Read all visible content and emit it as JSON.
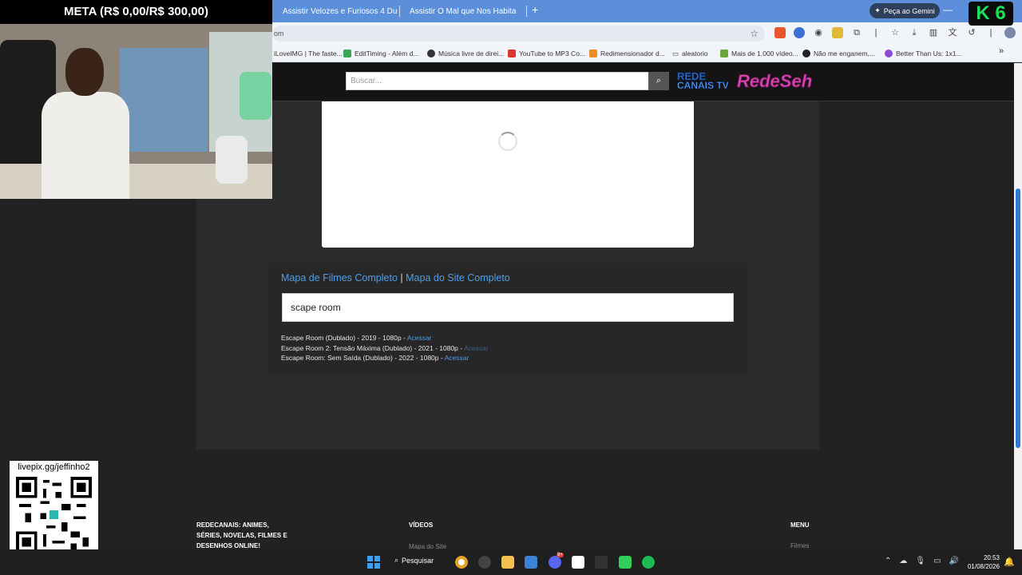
{
  "stream": {
    "meta_banner": "META (R$ 0,00/R$ 300,00)",
    "qr_label": "livepix.gg/jeffinho2",
    "overlay_badge": "K 6"
  },
  "browser": {
    "tabs": [
      {
        "title": "Assistir Velozes e Furiosos 4 Du",
        "close": "✕"
      },
      {
        "title": "Assistir O Mal que Nos Habita",
        "close": "✕"
      }
    ],
    "new_tab": "+",
    "gemini_button": "Peça ao Gemini",
    "address": "om",
    "bookmarks": [
      "iLoveIMG | The faste...",
      "EditTiming - Além d...",
      "Música livre de direi...",
      "YouTube to MP3 Co...",
      "Redimensionador d...",
      "aleatorio",
      "Mais de 1.000 vídeo...",
      "Não me enganem,...",
      "Better Than Us: 1x1..."
    ]
  },
  "site": {
    "search_placeholder": "Buscar...",
    "logo_line1": "REDE",
    "logo_line2": "CANAIS TV",
    "logo_line3": "RedeSeh",
    "map_link_films": "Mapa de Filmes Completo",
    "map_separator": "|",
    "map_link_site": "Mapa do Site Completo",
    "filter_value": "scape room",
    "results": [
      {
        "text": "Escape Room (Dublado) - 2019 - 1080p - ",
        "link": "Acessar",
        "visited": false
      },
      {
        "text": "Escape Room 2: Tensão Máxima (Dublado) - 2021 - 1080p - ",
        "link": "Acessar",
        "visited": true
      },
      {
        "text": "Escape Room: Sem Saída (Dublado) - 2022 - 1080p - ",
        "link": "Acessar",
        "visited": false
      }
    ],
    "footer": {
      "about_title": "REDECANAIS: ANIMES, SÉRIES, NOVELAS, FILMES E DESENHOS ONLINE!",
      "videos_title": "VÍDEOS",
      "videos_link": "Mapa do Site",
      "menu_title": "MENU",
      "menu_link": "Filmes"
    }
  },
  "taskbar": {
    "search_label": "Pesquisar",
    "time": "20:53",
    "date": "01/08/2026",
    "discord_badge": "9+"
  }
}
